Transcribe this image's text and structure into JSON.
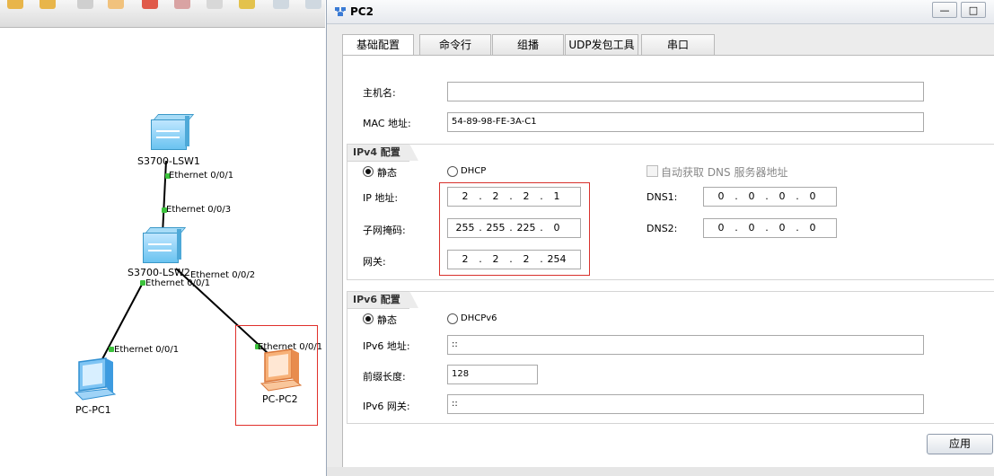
{
  "topology": {
    "devices": [
      {
        "id": "lsw1",
        "label": "S3700-LSW1"
      },
      {
        "id": "lsw2",
        "label": "S3700-LSW2"
      },
      {
        "id": "pc1",
        "label": "PC-PC1"
      },
      {
        "id": "pc2",
        "label": "PC-PC2"
      }
    ],
    "ports": {
      "lsw1_down": "Ethernet 0/0/1",
      "lsw2_up": "Ethernet 0/0/3",
      "lsw2_pc1": "Ethernet 0/0/1",
      "lsw2_pc2": "Ethernet 0/0/2",
      "pc1_port": "Ethernet 0/0/1",
      "pc2_port": "Ethernet 0/0/1"
    },
    "link_dot_color": "#3cc23c",
    "highlight_color": "#e0302b"
  },
  "window": {
    "title": "PC2",
    "minimize": "—",
    "maximize": "□",
    "tabs": [
      {
        "label": "基础配置",
        "active": true
      },
      {
        "label": "命令行",
        "active": false
      },
      {
        "label": "组播",
        "active": false
      },
      {
        "label": "UDP发包工具",
        "active": false
      },
      {
        "label": "串口",
        "active": false
      }
    ]
  },
  "basic": {
    "hostname_label": "主机名:",
    "hostname_value": "",
    "mac_label": "MAC 地址:",
    "mac_value": "54-89-98-FE-3A-C1"
  },
  "ipv4": {
    "header": "IPv4 配置",
    "static_label": "静态",
    "dhcp_label": "DHCP",
    "mode": "static",
    "auto_dns_label": "自动获取 DNS 服务器地址",
    "ip_label": "IP 地址:",
    "ip": [
      "2",
      "2",
      "2",
      "1"
    ],
    "mask_label": "子网掩码:",
    "mask": [
      "255",
      "255",
      "225",
      "0"
    ],
    "gw_label": "网关:",
    "gw": [
      "2",
      "2",
      "2",
      "254"
    ],
    "dns1_label": "DNS1:",
    "dns1": [
      "0",
      "0",
      "0",
      "0"
    ],
    "dns2_label": "DNS2:",
    "dns2": [
      "0",
      "0",
      "0",
      "0"
    ],
    "dot": "."
  },
  "ipv6": {
    "header": "IPv6 配置",
    "static_label": "静态",
    "dhcp_label": "DHCPv6",
    "mode": "static",
    "addr_label": "IPv6 地址:",
    "addr_value": "::",
    "prefix_label": "前缀长度:",
    "prefix_value": "128",
    "gw_label": "IPv6 网关:",
    "gw_value": "::"
  },
  "apply_label": "应用"
}
